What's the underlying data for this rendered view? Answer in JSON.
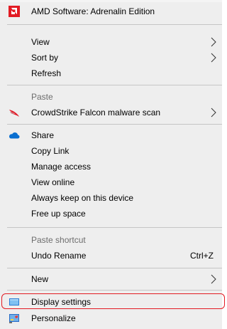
{
  "menu": {
    "items": [
      {
        "label": "AMD Software: Adrenalin Edition",
        "icon": "amd-logo-icon"
      },
      {
        "label": "View",
        "submenu": true
      },
      {
        "label": "Sort by",
        "submenu": true
      },
      {
        "label": "Refresh"
      },
      {
        "label": "Paste",
        "disabled": true
      },
      {
        "label": "CrowdStrike Falcon malware scan",
        "icon": "crowdstrike-falcon-icon",
        "submenu": true
      },
      {
        "label": "Share",
        "icon": "onedrive-cloud-icon"
      },
      {
        "label": "Copy Link"
      },
      {
        "label": "Manage access"
      },
      {
        "label": "View online"
      },
      {
        "label": "Always keep on this device"
      },
      {
        "label": "Free up space"
      },
      {
        "label": "Paste shortcut",
        "disabled": true
      },
      {
        "label": "Undo Rename",
        "shortcut": "Ctrl+Z"
      },
      {
        "label": "New",
        "submenu": true
      },
      {
        "label": "Display settings",
        "icon": "display-monitor-icon",
        "highlighted": true
      },
      {
        "label": "Personalize",
        "icon": "personalize-icon"
      }
    ]
  },
  "colors": {
    "menu_background": "#eeeeee",
    "separator": "#c5c5c5",
    "disabled_text": "#6d6d6d",
    "highlight_ring": "#e31b23",
    "amd_red": "#e21b23",
    "onedrive_blue": "#0a6fd0"
  }
}
